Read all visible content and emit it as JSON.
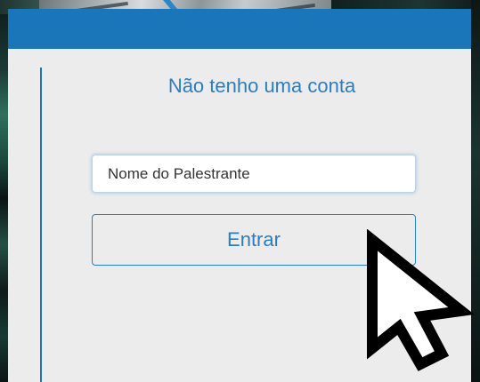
{
  "panel": {
    "title": "Não tenho uma conta",
    "header_color": "#1a76b9",
    "accent_color": "#2a7dc0",
    "background_color": "#ececec"
  },
  "form": {
    "name_input": {
      "value": "Nome do Palestrante"
    },
    "submit_label": "Entrar"
  },
  "cursor": {
    "icon": "arrow-pointer-icon"
  }
}
